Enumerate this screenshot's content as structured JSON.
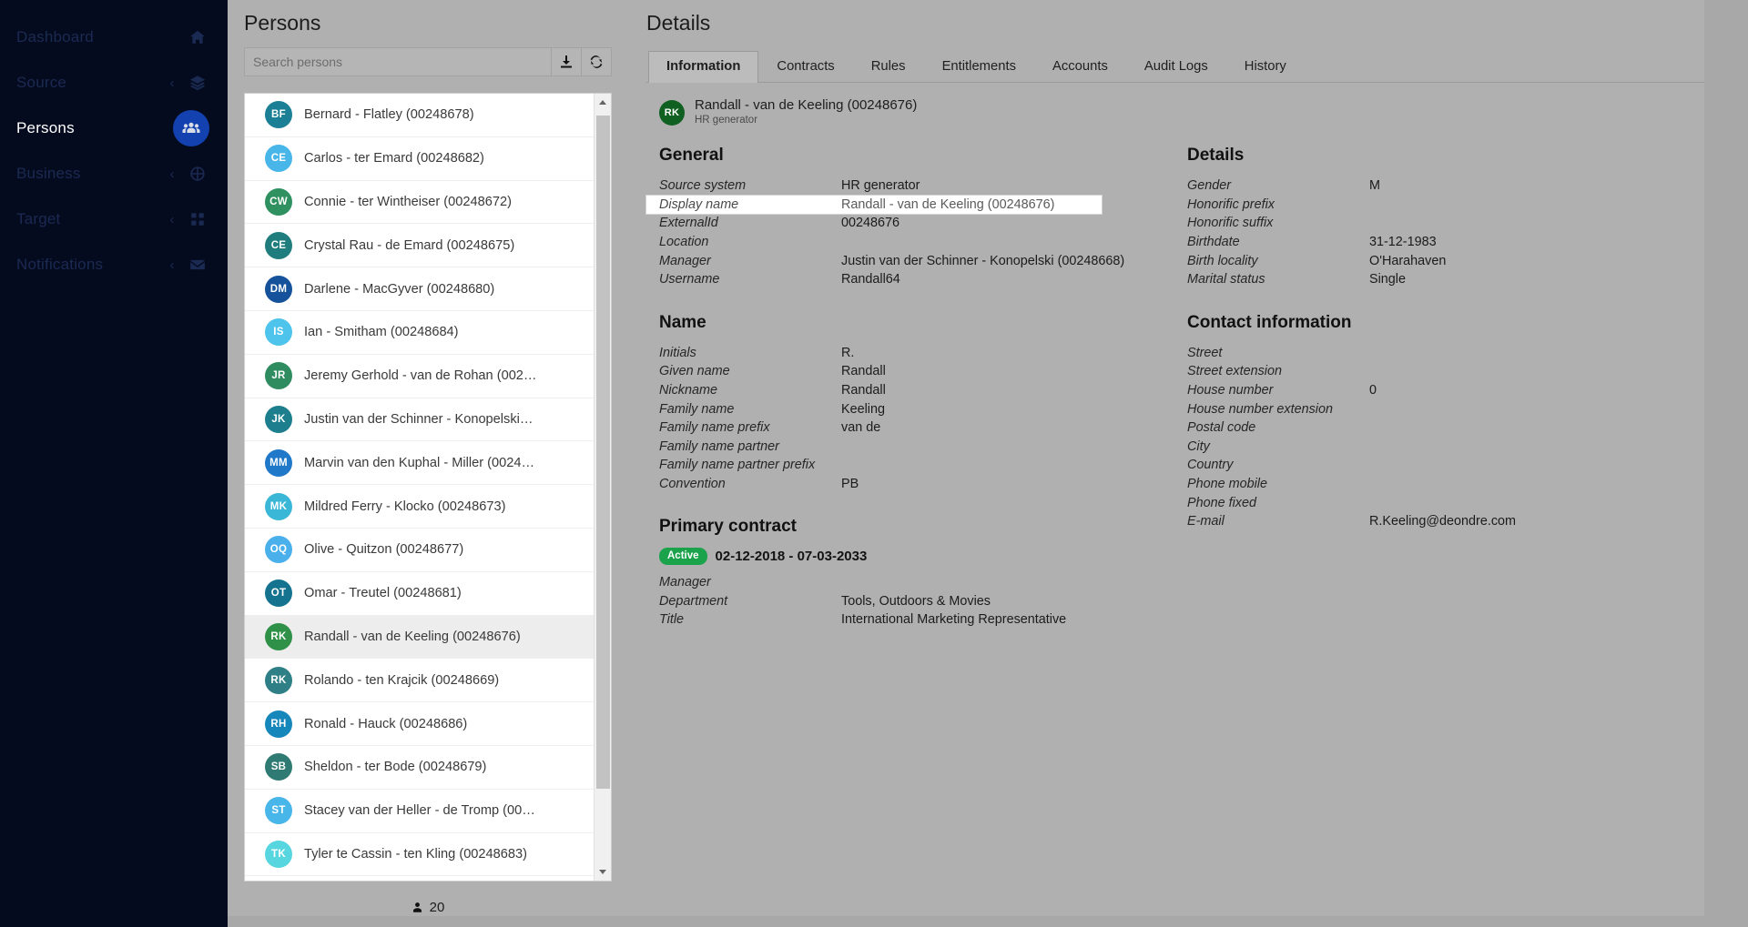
{
  "sidebar": {
    "items": [
      {
        "label": "Dashboard",
        "icon": "home-icon",
        "caret": "",
        "active": false
      },
      {
        "label": "Source",
        "icon": "layers-icon",
        "caret": "‹",
        "active": false
      },
      {
        "label": "Persons",
        "icon": "people-icon",
        "caret": "",
        "active": true
      },
      {
        "label": "Business",
        "icon": "sitemap-icon",
        "caret": "‹",
        "active": false
      },
      {
        "label": "Target",
        "icon": "grid-icon",
        "caret": "‹",
        "active": false
      },
      {
        "label": "Notifications",
        "icon": "envelope-icon",
        "caret": "‹",
        "active": false
      }
    ]
  },
  "list_pane": {
    "title": "Persons",
    "search": {
      "value": "",
      "placeholder": "Search persons"
    },
    "download_icon": "download-icon",
    "refresh_icon": "refresh-icon",
    "footer": {
      "icon": "person-icon",
      "count": "20"
    },
    "persons": [
      {
        "initials": "BF",
        "name": "Bernard - Flatley (00248678)",
        "color": "#1b7f95",
        "selected": false
      },
      {
        "initials": "CE",
        "name": "Carlos - ter Emard (00248682)",
        "color": "#49b6ea",
        "selected": false
      },
      {
        "initials": "CW",
        "name": "Connie - ter Wintheiser (00248672)",
        "color": "#2f9160",
        "selected": false
      },
      {
        "initials": "CE",
        "name": "Crystal Rau - de Emard (00248675)",
        "color": "#1f7d7d",
        "selected": false
      },
      {
        "initials": "DM",
        "name": "Darlene - MacGyver (00248680)",
        "color": "#15529b",
        "selected": false
      },
      {
        "initials": "IS",
        "name": "Ian - Smitham (00248684)",
        "color": "#4ec3ec",
        "selected": false
      },
      {
        "initials": "JR",
        "name": "Jeremy Gerhold - van de Rohan (002…",
        "color": "#2f8b60",
        "selected": false
      },
      {
        "initials": "JK",
        "name": "Justin van der Schinner - Konopelski…",
        "color": "#1d7f8e",
        "selected": false
      },
      {
        "initials": "MM",
        "name": "Marvin van den Kuphal - Miller (0024…",
        "color": "#1f78c8",
        "selected": false
      },
      {
        "initials": "MK",
        "name": "Mildred Ferry - Klocko (00248673)",
        "color": "#3ab7d6",
        "selected": false
      },
      {
        "initials": "OQ",
        "name": "Olive - Quitzon (00248677)",
        "color": "#49b0ec",
        "selected": false
      },
      {
        "initials": "OT",
        "name": "Omar - Treutel (00248681)",
        "color": "#15738f",
        "selected": false
      },
      {
        "initials": "RK",
        "name": "Randall - van de Keeling (00248676)",
        "color": "#2f9148",
        "selected": true
      },
      {
        "initials": "RK",
        "name": "Rolando - ten Krajcik (00248669)",
        "color": "#2f7f86",
        "selected": false
      },
      {
        "initials": "RH",
        "name": "Ronald - Hauck (00248686)",
        "color": "#1587bb",
        "selected": false
      },
      {
        "initials": "SB",
        "name": "Sheldon - ter Bode (00248679)",
        "color": "#2f7a72",
        "selected": false
      },
      {
        "initials": "ST",
        "name": "Stacey van der Heller - de Tromp (00…",
        "color": "#49b6ea",
        "selected": false
      },
      {
        "initials": "TK",
        "name": "Tyler te Cassin - ten Kling (00248683)",
        "color": "#57d6e0",
        "selected": false
      }
    ]
  },
  "details": {
    "title": "Details",
    "tabs": [
      {
        "label": "Information",
        "active": true
      },
      {
        "label": "Contracts",
        "active": false
      },
      {
        "label": "Rules",
        "active": false
      },
      {
        "label": "Entitlements",
        "active": false
      },
      {
        "label": "Accounts",
        "active": false
      },
      {
        "label": "Audit Logs",
        "active": false
      },
      {
        "label": "History",
        "active": false
      }
    ],
    "person": {
      "initials": "RK",
      "avatar_color": "#0f6021",
      "name": "Randall - van de Keeling (00248676)",
      "source": "HR generator"
    },
    "general": {
      "title": "General",
      "fields": [
        {
          "label": "Source system",
          "value": "HR generator",
          "highlight": false
        },
        {
          "label": "Display name",
          "value": "Randall - van de Keeling (00248676)",
          "highlight": true
        },
        {
          "label": "ExternalId",
          "value": "00248676",
          "highlight": false
        },
        {
          "label": "Location",
          "value": "",
          "highlight": false
        },
        {
          "label": "Manager",
          "value": "Justin van der Schinner - Konopelski (00248668)",
          "highlight": false
        },
        {
          "label": "Username",
          "value": "Randall64",
          "highlight": false
        }
      ]
    },
    "name": {
      "title": "Name",
      "fields": [
        {
          "label": "Initials",
          "value": "R."
        },
        {
          "label": "Given name",
          "value": "Randall"
        },
        {
          "label": "Nickname",
          "value": "Randall"
        },
        {
          "label": "Family name",
          "value": "Keeling"
        },
        {
          "label": "Family name prefix",
          "value": "van de"
        },
        {
          "label": "Family name partner",
          "value": ""
        },
        {
          "label": "Family name partner prefix",
          "value": ""
        },
        {
          "label": "Convention",
          "value": "PB"
        }
      ]
    },
    "details_col": {
      "title": "Details",
      "fields": [
        {
          "label": "Gender",
          "value": "M"
        },
        {
          "label": "Honorific prefix",
          "value": ""
        },
        {
          "label": "Honorific suffix",
          "value": ""
        },
        {
          "label": "Birthdate",
          "value": "31-12-1983"
        },
        {
          "label": "Birth locality",
          "value": "O'Harahaven"
        },
        {
          "label": "Marital status",
          "value": "Single"
        }
      ]
    },
    "contact": {
      "title": "Contact information",
      "fields": [
        {
          "label": "Street",
          "value": ""
        },
        {
          "label": "Street extension",
          "value": ""
        },
        {
          "label": "House number",
          "value": "0"
        },
        {
          "label": "House number extension",
          "value": ""
        },
        {
          "label": "Postal code",
          "value": ""
        },
        {
          "label": "City",
          "value": ""
        },
        {
          "label": "Country",
          "value": ""
        },
        {
          "label": "Phone mobile",
          "value": ""
        },
        {
          "label": "Phone fixed",
          "value": ""
        },
        {
          "label": "E-mail",
          "value": "R.Keeling@deondre.com"
        }
      ]
    },
    "primary_contract": {
      "title": "Primary contract",
      "status_badge": "Active",
      "dates": "02-12-2018 - 07-03-2033",
      "fields": [
        {
          "label": "Manager",
          "value": ""
        },
        {
          "label": "Department",
          "value": "Tools, Outdoors & Movies"
        },
        {
          "label": "Title",
          "value": "International Marketing Representative"
        }
      ]
    }
  },
  "colors": {
    "sidebar_bg": "#050b1f",
    "accent": "#1342b0",
    "panel_bg": "#b0b0b0",
    "badge_green": "#1aa34a"
  }
}
